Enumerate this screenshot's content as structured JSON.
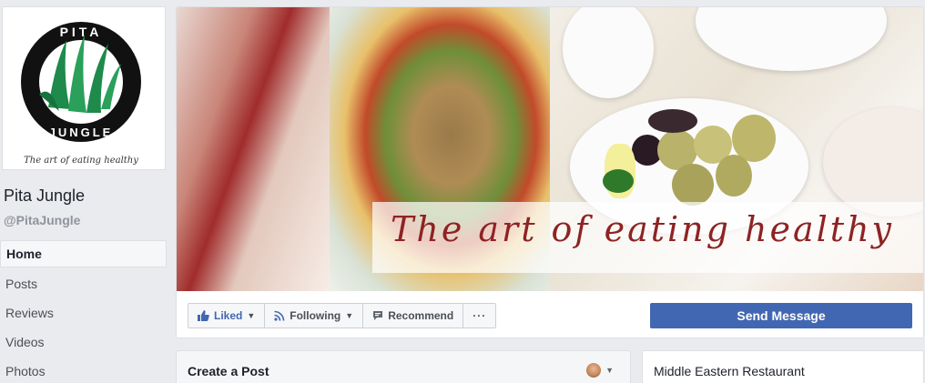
{
  "page": {
    "name": "Pita Jungle",
    "handle": "@PitaJungle"
  },
  "logo": {
    "word_top": "PITA",
    "word_bottom": "JUNGLE",
    "tagline": "The art of eating healthy"
  },
  "nav": {
    "items": [
      {
        "label": "Home",
        "active": true
      },
      {
        "label": "Posts"
      },
      {
        "label": "Reviews"
      },
      {
        "label": "Videos"
      },
      {
        "label": "Photos"
      }
    ]
  },
  "cover": {
    "script_text": "The art of eating healthy"
  },
  "actions": {
    "liked": "Liked",
    "following": "Following",
    "recommend": "Recommend",
    "more": "···",
    "send_message": "Send Message"
  },
  "create_post": {
    "title": "Create a Post"
  },
  "about": {
    "category": "Middle Eastern Restaurant"
  },
  "colors": {
    "brand_blue": "#4267b2",
    "background": "#e9ebee",
    "logo_green": "#1e8a4c",
    "script_red": "#8e2323"
  }
}
